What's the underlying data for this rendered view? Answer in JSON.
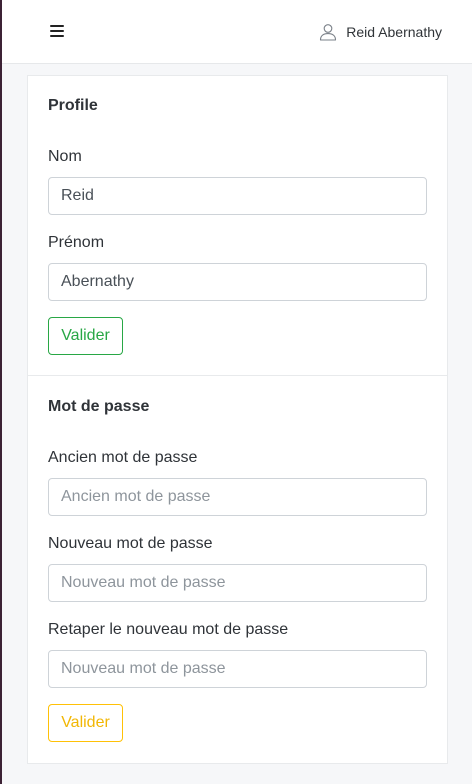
{
  "header": {
    "user_name": "Reid Abernathy",
    "icons": {
      "menu": "hamburger-icon",
      "user": "user-icon"
    }
  },
  "profile": {
    "title": "Profile",
    "last_name_label": "Nom",
    "last_name_value": "Reid",
    "first_name_label": "Prénom",
    "first_name_value": "Abernathy",
    "submit_label": "Valider",
    "submit_color": "#28a745"
  },
  "password": {
    "title": "Mot de passe",
    "old_label": "Ancien mot de passe",
    "old_placeholder": "Ancien mot de passe",
    "new_label": "Nouveau mot de passe",
    "new_placeholder": "Nouveau mot de passe",
    "confirm_label": "Retaper le nouveau mot de passe",
    "confirm_placeholder": "Nouveau mot de passe",
    "submit_label": "Valider",
    "submit_color": "#ffc107"
  }
}
